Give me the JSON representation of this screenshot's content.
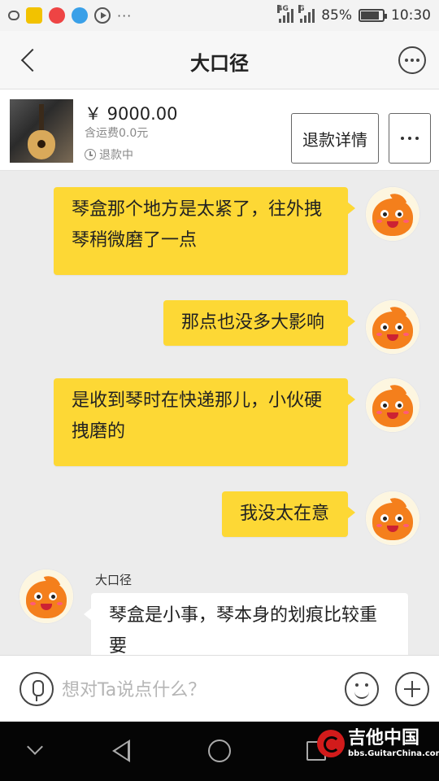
{
  "status_bar": {
    "network_4g": "4G",
    "network_g": "G",
    "battery": "85%",
    "battery_level": 0.85,
    "time": "10:30",
    "more": "···"
  },
  "header": {
    "title": "大口径"
  },
  "product": {
    "price": "￥ 9000.00",
    "shipping": "含运费0.0元",
    "status": "退款中",
    "refund_button": "退款详情"
  },
  "messages": [
    {
      "direction": "out",
      "text": "琴盒那个地方是太紧了，往外拽琴稍微磨了一点"
    },
    {
      "direction": "out",
      "text": "那点也没多大影响"
    },
    {
      "direction": "out",
      "text": "是收到琴时在快递那儿，小伙硬拽磨的"
    },
    {
      "direction": "out",
      "text": "我没太在意"
    },
    {
      "direction": "in",
      "sender": "大口径",
      "text": "琴盒是小事，琴本身的划痕比较重要"
    }
  ],
  "input": {
    "placeholder": "想对Ta说点什么？"
  },
  "watermark": {
    "main": "吉他中国",
    "sub": "bbs.GuitarChina.com"
  }
}
